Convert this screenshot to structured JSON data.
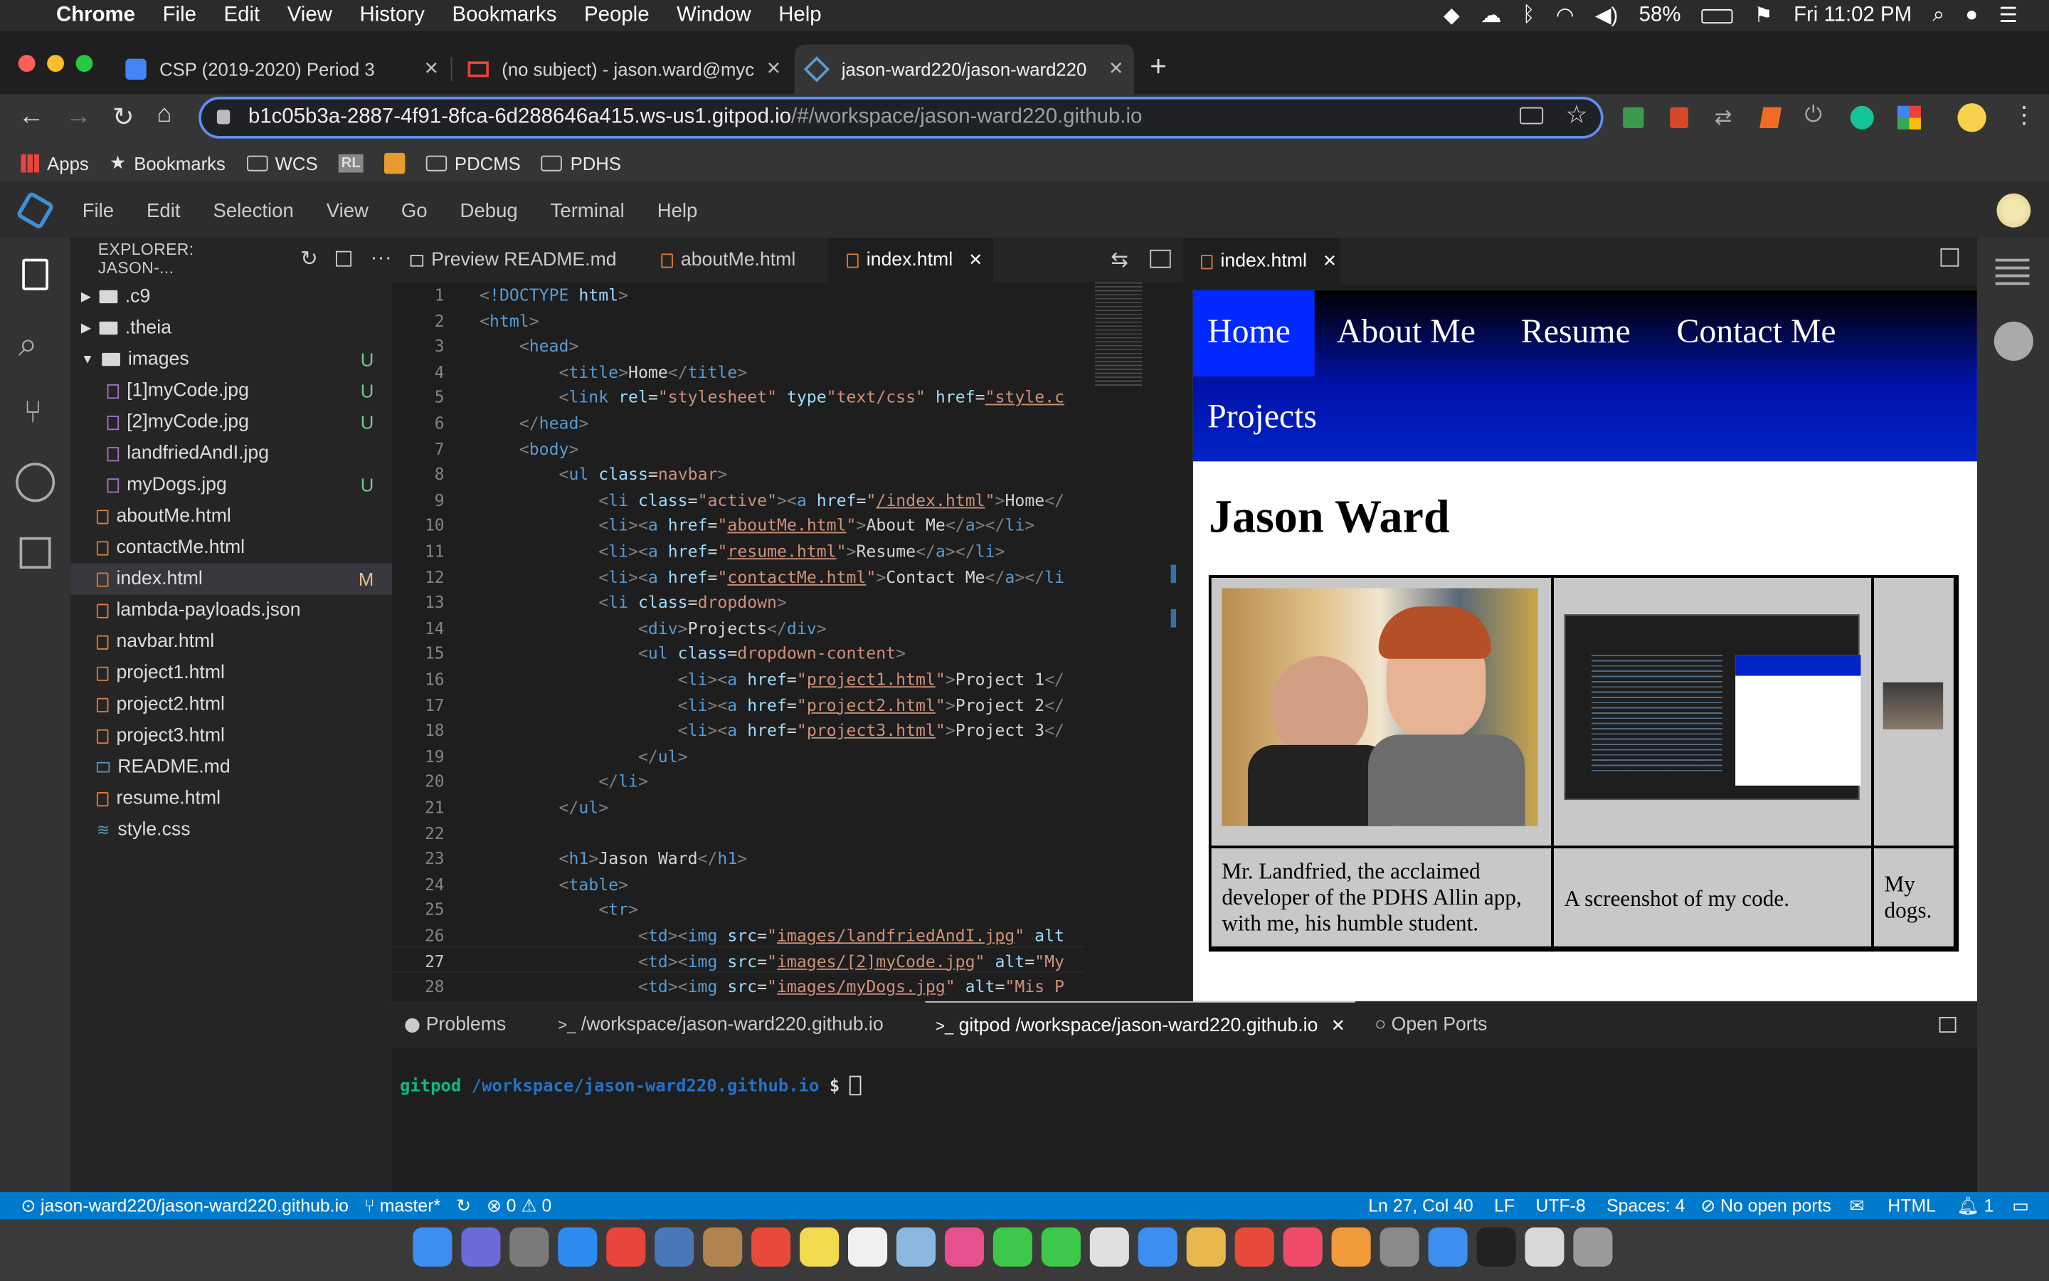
{
  "menubar": {
    "items": [
      "Chrome",
      "File",
      "Edit",
      "View",
      "History",
      "Bookmarks",
      "People",
      "Window",
      "Help"
    ],
    "battery": "58%",
    "clock": "Fri 11:02 PM"
  },
  "browser": {
    "tabs": [
      {
        "title": "CSP (2019-2020) Period 3",
        "icon": "google-classroom-icon"
      },
      {
        "title": "(no subject) - jason.ward@myc",
        "icon": "gmail-icon"
      },
      {
        "title": "jason-ward220/jason-ward220",
        "icon": "gitpod-icon"
      }
    ],
    "address": "b1c05b3a-2887-4f91-8fca-6d288646a415.ws-us1.gitpod.io",
    "address_tail": "/#/workspace/jason-ward220.github.io",
    "bookmarks": [
      "Apps",
      "Bookmarks",
      "WCS",
      "RL",
      "PDCMS",
      "PDHS"
    ]
  },
  "ide": {
    "menu": [
      "File",
      "Edit",
      "Selection",
      "View",
      "Go",
      "Debug",
      "Terminal",
      "Help"
    ],
    "explorer_title": "EXPLORER: JASON-...",
    "tree": [
      {
        "label": ".c9",
        "type": "folder",
        "badge": ""
      },
      {
        "label": ".theia",
        "type": "folder",
        "badge": ""
      },
      {
        "label": "images",
        "type": "folder-open",
        "badge": "U"
      },
      {
        "label": "[1]myCode.jpg",
        "type": "image",
        "badge": "U"
      },
      {
        "label": "[2]myCode.jpg",
        "type": "image",
        "badge": "U"
      },
      {
        "label": "landfriedAndI.jpg",
        "type": "image",
        "badge": ""
      },
      {
        "label": "myDogs.jpg",
        "type": "image",
        "badge": "U"
      },
      {
        "label": "aboutMe.html",
        "type": "html",
        "badge": ""
      },
      {
        "label": "contactMe.html",
        "type": "html",
        "badge": ""
      },
      {
        "label": "index.html",
        "type": "html",
        "badge": "M"
      },
      {
        "label": "lambda-payloads.json",
        "type": "html",
        "badge": ""
      },
      {
        "label": "navbar.html",
        "type": "html",
        "badge": ""
      },
      {
        "label": "project1.html",
        "type": "html",
        "badge": ""
      },
      {
        "label": "project2.html",
        "type": "html",
        "badge": ""
      },
      {
        "label": "project3.html",
        "type": "html",
        "badge": ""
      },
      {
        "label": "README.md",
        "type": "md",
        "badge": ""
      },
      {
        "label": "resume.html",
        "type": "html",
        "badge": ""
      },
      {
        "label": "style.css",
        "type": "css",
        "badge": ""
      }
    ],
    "editor_tabs": [
      "Preview README.md",
      "aboutMe.html",
      "index.html"
    ],
    "preview_tab": "index.html",
    "terminal_tabs": [
      "Problems",
      "/workspace/jason-ward220.github.io",
      "gitpod /workspace/jason-ward220.github.io",
      "Open Ports"
    ],
    "terminal_prompt_user": "gitpod",
    "terminal_prompt_path": "/workspace/jason-ward220.github.io",
    "terminal_prompt_sign": "$"
  },
  "preview": {
    "nav": [
      "Home",
      "About Me",
      "Resume",
      "Contact Me",
      "Projects"
    ],
    "heading": "Jason Ward",
    "captions": [
      "Mr. Landfried, the acclaimed developer of the PDHS Allin app, with me, his humble student.",
      "A screenshot of my code.",
      "My dogs."
    ]
  },
  "status": {
    "repo": "jason-ward220/jason-ward220.github.io",
    "branch": "master*",
    "errors": "0",
    "warnings": "0",
    "cursor": "Ln 27, Col 40",
    "eol": "LF",
    "encoding": "UTF-8",
    "spaces": "Spaces: 4",
    "ports": "No open ports",
    "language": "HTML",
    "notifications": "1"
  },
  "colors": {
    "accent": "#007acc",
    "active_line": "#0024c8"
  }
}
